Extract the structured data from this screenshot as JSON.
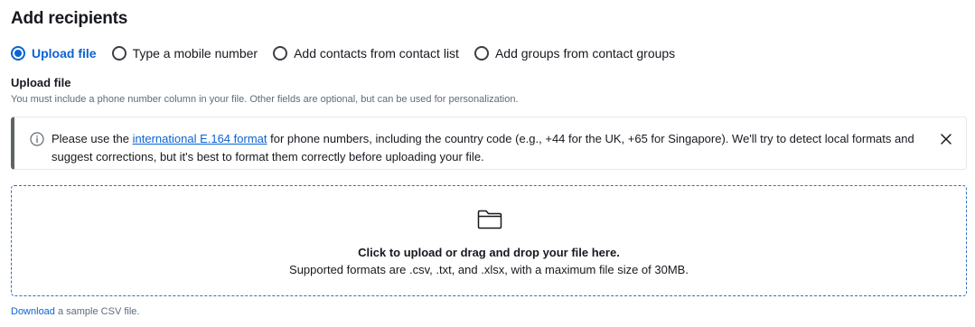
{
  "page": {
    "title": "Add recipients"
  },
  "recipient_options": [
    {
      "label": "Upload file",
      "selected": true
    },
    {
      "label": "Type a mobile number",
      "selected": false
    },
    {
      "label": "Add contacts from contact list",
      "selected": false
    },
    {
      "label": "Add groups from contact groups",
      "selected": false
    }
  ],
  "upload_section": {
    "title": "Upload file",
    "description": "You must include a phone number column in your file. Other fields are optional, but can be used for personalization."
  },
  "alert": {
    "icon": "info-icon",
    "text_before": "Please use the ",
    "link_text": "international E.164 format",
    "text_after": " for phone numbers, including the country code (e.g., +44 for the UK, +65 for Singapore). We'll try to detect local formats and suggest corrections, but it's best to format them correctly before uploading your file.",
    "close_icon": "close-icon"
  },
  "dropzone": {
    "icon": "folder-icon",
    "primary_text": "Click to upload or drag and drop your file here.",
    "secondary_text": "Supported formats are .csv, .txt, and .xlsx, with a maximum file size of 30MB."
  },
  "footer": {
    "link_text": "Download",
    "text": " a sample CSV file."
  },
  "colors": {
    "accent": "#0b63d3",
    "alert_bar": "#5f6366",
    "dropzone_border": "#2f6fc6"
  }
}
